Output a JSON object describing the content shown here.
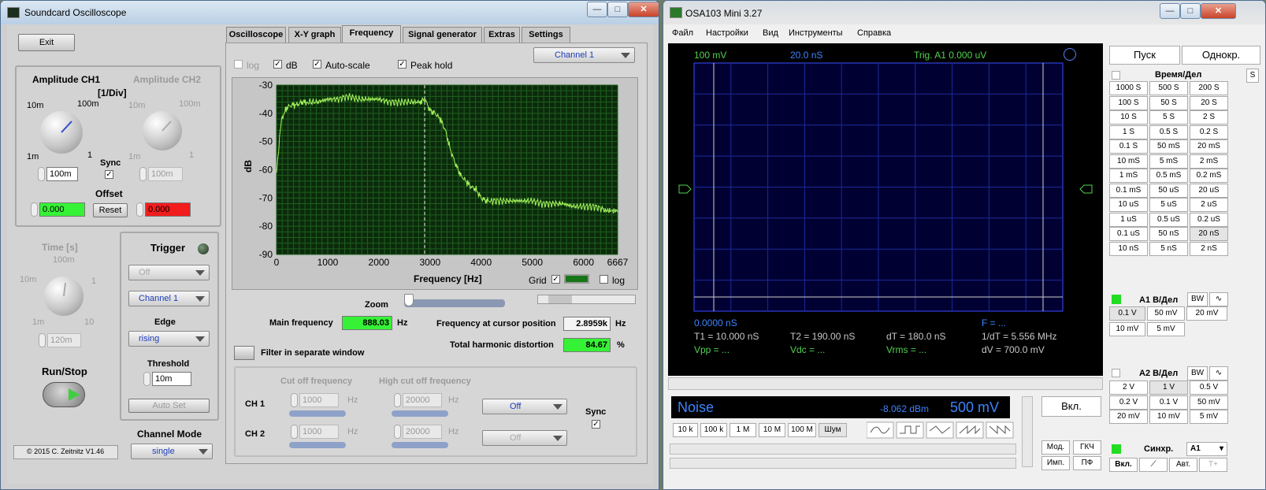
{
  "sc": {
    "title": "Soundcard Oscilloscope",
    "exit": "Exit",
    "tabs": [
      "Oscilloscope",
      "X-Y graph",
      "Frequency",
      "Signal generator",
      "Extras",
      "Settings"
    ],
    "amp_ch1": "Amplitude CH1",
    "amp_ch2": "Amplitude CH2",
    "div": "[1/Div]",
    "k1_labels": [
      "10m",
      "100m",
      "1m",
      "1"
    ],
    "k2_labels": [
      "10m",
      "100m",
      "1m",
      "1"
    ],
    "sync": "Sync",
    "ch1_val": "100m",
    "ch2_val": "100m",
    "offset": "Offset",
    "off1": "0.000",
    "off2": "0.000",
    "reset": "Reset",
    "time": "Time [s]",
    "t_labels": [
      "100m",
      "10m",
      "1",
      "1m",
      "10"
    ],
    "time_val": "120m",
    "trigger": "Trigger",
    "trig_mode": "Off",
    "trig_ch": "Channel 1",
    "edge": "Edge",
    "edge_val": "rising",
    "threshold": "Threshold",
    "thr_val": "10m",
    "autoset": "Auto Set",
    "runstop": "Run/Stop",
    "copyright": "© 2015  C. Zeitnitz V1.46",
    "chmode": "Channel Mode",
    "chmode_val": "single",
    "log": "log",
    "db": "dB",
    "autoscale": "Auto-scale",
    "peakhold": "Peak hold",
    "channel": "Channel 1",
    "zoom": "Zoom",
    "main_freq": "Main frequency",
    "main_freq_val": "888.03",
    "hz": "Hz",
    "fcursor": "Frequency at cursor position",
    "fcursor_val": "2.8959k",
    "thd": "Total harmonic distortion",
    "thd_val": "84.67",
    "pct": "%",
    "filter": "Filter in separate window",
    "cutoff": "Cut off frequency",
    "hicut": "High cut off frequency",
    "ch1": "CH 1",
    "ch2": "CH 2",
    "c1": "1000",
    "c2": "1000",
    "h1": "20000",
    "h2": "20000",
    "f1": "Off",
    "f2": "Off",
    "fsync": "Sync",
    "grid": "Grid",
    "glog": "log"
  },
  "chart_data": {
    "type": "line",
    "xlabel": "Frequency [Hz]",
    "ylabel": "dB",
    "xlim": [
      0,
      6667
    ],
    "ylim": [
      -90,
      -30
    ],
    "xticks": [
      "0",
      "1000",
      "2000",
      "3000",
      "4000",
      "5000",
      "6000",
      "6667"
    ],
    "yticks": [
      "-30",
      "-40",
      "-50",
      "-60",
      "-70",
      "-80",
      "-90"
    ],
    "cursor_x": 2896,
    "series": [
      {
        "x": [
          0,
          30,
          60,
          100,
          150,
          200,
          300,
          400,
          500,
          600,
          800,
          1000,
          1200,
          1400,
          1600,
          1800,
          2000,
          2200,
          2400,
          2600,
          2800,
          2900,
          3000,
          3100,
          3200,
          3300,
          3400,
          3500,
          3600,
          3700,
          3800,
          3900,
          4000,
          4100,
          4200,
          4400,
          4600,
          4800,
          5000,
          5200,
          5400,
          5600,
          5800,
          6000,
          6200,
          6400,
          6667
        ],
        "y": [
          -61,
          -55,
          -48,
          -42,
          -40,
          -38,
          -37,
          -37,
          -36,
          -36,
          -36,
          -35,
          -35,
          -34,
          -35,
          -35,
          -35,
          -36,
          -36,
          -36,
          -36,
          -35,
          -39,
          -40,
          -42,
          -46,
          -53,
          -58,
          -62,
          -64,
          -66,
          -67,
          -70,
          -71,
          -71,
          -71,
          -71,
          -71,
          -71,
          -72,
          -72,
          -72,
          -73,
          -73,
          -73,
          -74,
          -75
        ]
      }
    ]
  },
  "osa": {
    "title": "OSA103 Mini 3.27",
    "menu": [
      "Файл",
      "Настройки",
      "Вид",
      "Инструменты",
      "Справка"
    ],
    "top_volt": "100 mV",
    "top_time": "20.0 nS",
    "top_trig": "Trig. A1  0.000 uV",
    "ns": "0.0000 nS",
    "f": "F = ...",
    "t1": "T1 = 10.000 nS",
    "t2": "T2 = 190.00 nS",
    "dt": "dT = 180.0 nS",
    "inv": "1/dT = 5.556 MHz",
    "vpp": "Vpp = ...",
    "vdc": "Vdc = ...",
    "vrms": "Vrms = ...",
    "dv": "dV = 700.0 mV",
    "noise": "Noise",
    "dbm": "-8.062 dBm",
    "mv": "500 mV",
    "on": "Вкл.",
    "gen": [
      "10 k",
      "100 k",
      "1 M",
      "10 M",
      "100 M",
      "Шум"
    ],
    "mod": "Мод.",
    "gch": "ГКЧ",
    "imp": "Имп.",
    "pf": "ПФ",
    "start": "Пуск",
    "single": "Однокр.",
    "time_div": "Время/Дел",
    "s": "S",
    "tbtns": [
      "1000 S",
      "500 S",
      "200 S",
      "100 S",
      "50 S",
      "20 S",
      "10 S",
      "5 S",
      "2 S",
      "1 S",
      "0.5 S",
      "0.2 S",
      "0.1 S",
      "50 mS",
      "20 mS",
      "10 mS",
      "5 mS",
      "2 mS",
      "1 mS",
      "0.5 mS",
      "0.2 mS",
      "0.1 mS",
      "50 uS",
      "20 uS",
      "10 uS",
      "5 uS",
      "2 uS",
      "1 uS",
      "0.5 uS",
      "0.2 uS",
      "0.1 uS",
      "50 nS",
      "20 nS",
      "10 nS",
      "5 nS",
      "2 nS"
    ],
    "a1": "A1 В/Дел",
    "bw": "BW",
    "a1btns": [
      "0.1 V",
      "50 mV",
      "20 mV",
      "10 mV",
      "5 mV"
    ],
    "a2": "A2 В/Дел",
    "a2btns": [
      "2 V",
      "1 V",
      "0.5 V",
      "0.2 V",
      "0.1 V",
      "50 mV",
      "20 mV",
      "10 mV",
      "5 mV"
    ],
    "sync": "Синхр.",
    "sync_ch": "A1",
    "von": "Вкл.",
    "avt": "Авт.",
    "tplus": "T+"
  }
}
